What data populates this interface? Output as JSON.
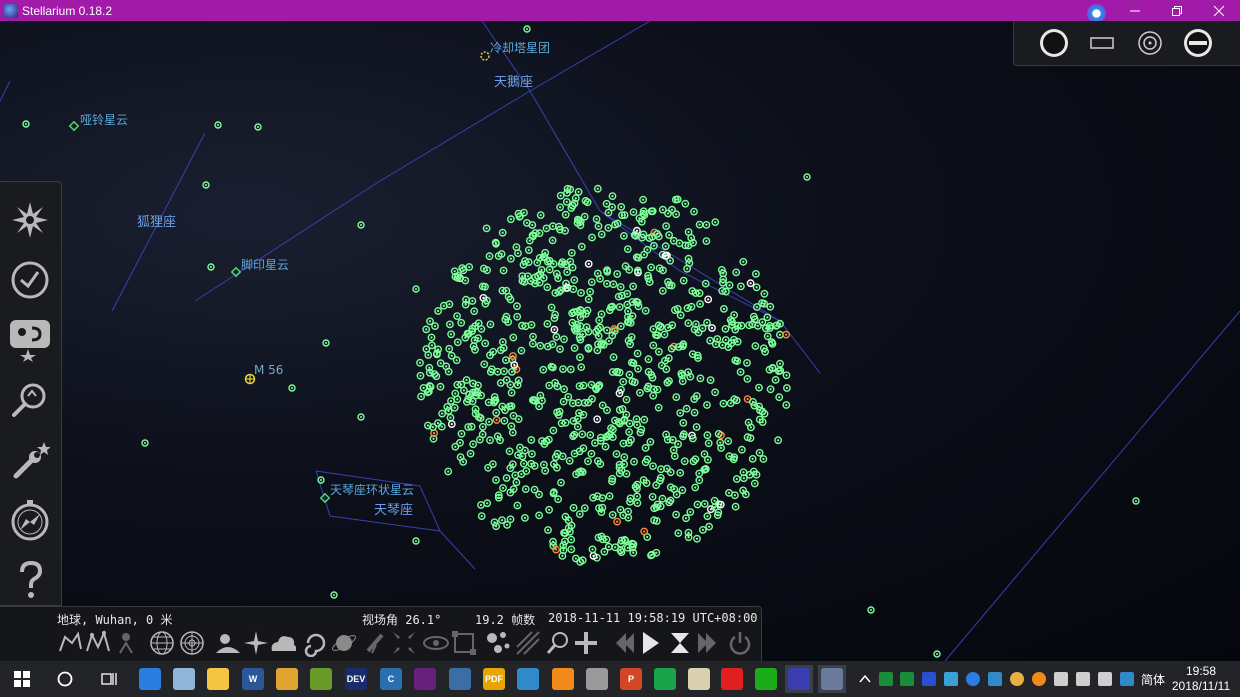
{
  "window": {
    "title": "Stellarium 0.18.2",
    "buttons": [
      "minimize",
      "restore",
      "close"
    ]
  },
  "sky": {
    "constellations": [
      {
        "name": "天鵝座",
        "id": "cygnus"
      },
      {
        "name": "狐狸座",
        "id": "vulpecula"
      },
      {
        "name": "天琴座",
        "id": "lyra"
      }
    ],
    "dso": [
      {
        "name": "冷却塔星团",
        "id": "cooling-tower-cluster"
      },
      {
        "name": "哑铃星云",
        "id": "dumbbell-nebula"
      },
      {
        "name": "脚印星云",
        "id": "footprint-nebula"
      },
      {
        "name": "天琴座环状星云",
        "id": "ring-nebula"
      },
      {
        "name": "M 56",
        "id": "m56"
      }
    ],
    "line_color": "#3b3fb0",
    "star_color": "#7dff9a",
    "cluster_color": "#e8d23a"
  },
  "left_toolbar": {
    "items": [
      {
        "name": "location-window",
        "icon": "sun-icon"
      },
      {
        "name": "date-time-window",
        "icon": "clock-icon"
      },
      {
        "name": "sky-viewing-options",
        "icon": "sky-options-icon"
      },
      {
        "name": "search-window",
        "icon": "search-icon"
      },
      {
        "name": "configuration-window",
        "icon": "wrench-icon"
      },
      {
        "name": "astronomical-calculations",
        "icon": "compass-icon"
      },
      {
        "name": "help-window",
        "icon": "help-icon"
      }
    ]
  },
  "top_right_panel": {
    "items": [
      {
        "name": "ocular-view",
        "icon": "circle-filled-icon"
      },
      {
        "name": "sensor-frame",
        "icon": "rectangle-icon"
      },
      {
        "name": "telrad-sight",
        "icon": "target-icon"
      },
      {
        "name": "ocular-config",
        "icon": "minus-circle-icon"
      }
    ]
  },
  "status": {
    "location": "地球, Wuhan, 0 米",
    "fov": "视场角 26.1°",
    "fps": "19.2 帧数",
    "datetime": "2018-11-11 19:58:19 UTC+08:00"
  },
  "bottom_toolbar": {
    "items": [
      "constellation-lines",
      "constellation-art",
      "constellation-boundaries-art",
      "equatorial-grid",
      "azimuthal-grid",
      "ground",
      "cardinal-points",
      "atmosphere",
      "nebulae",
      "planets-hint",
      "telescope",
      "flip-horizontal",
      "night-mode",
      "fullscreen",
      "deep-sky-selection",
      "meteor-showers",
      "satellite-search",
      "crosshair",
      "time-rewind",
      "time-play",
      "time-now",
      "time-forward",
      "quit"
    ]
  },
  "taskbar": {
    "time": "19:58",
    "date": "2018/11/11",
    "ime": "简体",
    "apps": [
      {
        "name": "start-button",
        "icon": "windows-icon"
      },
      {
        "name": "cortana-button",
        "icon": "circle-icon"
      },
      {
        "name": "task-view-button",
        "icon": "taskview-icon"
      },
      {
        "name": "app-sogou",
        "icon": "sogou-icon",
        "color": "#2a7de1"
      },
      {
        "name": "app-photos",
        "icon": "photos-icon",
        "color": "#8fb6d9"
      },
      {
        "name": "app-file-explorer",
        "icon": "folder-icon",
        "color": "#f4c542"
      },
      {
        "name": "app-word",
        "icon": "word-icon",
        "color": "#2b579a",
        "text": "W"
      },
      {
        "name": "app-chrome",
        "icon": "chrome-icon",
        "color": "#e0a531"
      },
      {
        "name": "app-editor",
        "icon": "editor-icon",
        "color": "#6a9a2a"
      },
      {
        "name": "app-dev-cpp",
        "icon": "dev-icon",
        "color": "#1a2c6b",
        "text": "DEV"
      },
      {
        "name": "app-codeblocks",
        "icon": "c-icon",
        "color": "#2a6fb0",
        "text": "C"
      },
      {
        "name": "app-visual-studio",
        "icon": "vs-icon",
        "color": "#68217a"
      },
      {
        "name": "app-remote-desktop",
        "icon": "remote-icon",
        "color": "#3a6ea5"
      },
      {
        "name": "app-pdf",
        "icon": "pdf-icon",
        "color": "#e8a400",
        "text": "PDF"
      },
      {
        "name": "app-reader",
        "icon": "reader-icon",
        "color": "#2f8ac7"
      },
      {
        "name": "app-search-tool",
        "icon": "search-icon",
        "color": "#f28a1a"
      },
      {
        "name": "app-pet",
        "icon": "pet-icon",
        "color": "#9a9a9a"
      },
      {
        "name": "app-powerpoint",
        "icon": "ppt-icon",
        "color": "#d24726",
        "text": "P"
      },
      {
        "name": "app-green",
        "icon": "recycle-icon",
        "color": "#19a34a"
      },
      {
        "name": "app-pdf-reader",
        "icon": "paper-icon",
        "color": "#d8d0b0"
      },
      {
        "name": "app-netease-music",
        "icon": "music-icon",
        "color": "#e02020"
      },
      {
        "name": "app-wechat",
        "icon": "chat-icon",
        "color": "#1aad19"
      },
      {
        "name": "app-stellarium",
        "icon": "stellarium-icon",
        "color": "#3a3db0"
      },
      {
        "name": "app-stellarium-2",
        "icon": "stellarium-icon",
        "color": "#6a7a9a"
      }
    ]
  }
}
